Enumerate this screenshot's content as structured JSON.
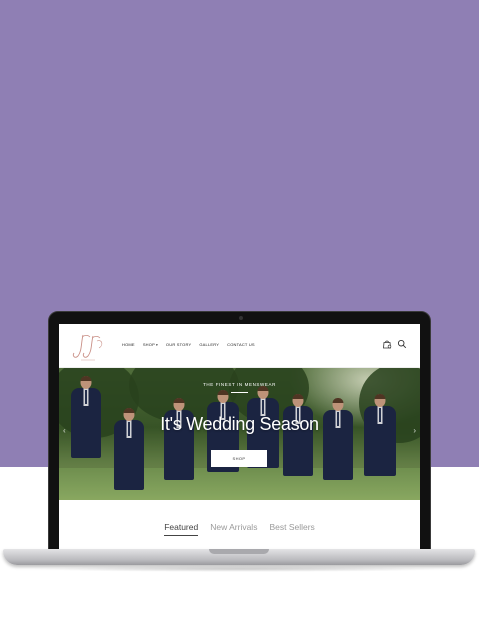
{
  "site": {
    "logo_alt": "J&J",
    "nav": [
      {
        "label": "HOME",
        "has_dropdown": false,
        "icon": ""
      },
      {
        "label": "SHOP",
        "has_dropdown": true,
        "icon": "chevron-down-icon"
      },
      {
        "label": "OUR STORY",
        "has_dropdown": false,
        "icon": ""
      },
      {
        "label": "GALLERY",
        "has_dropdown": false,
        "icon": ""
      },
      {
        "label": "CONTACT US",
        "has_dropdown": false,
        "icon": ""
      }
    ],
    "icons": [
      "shopping-bag-icon",
      "search-icon"
    ],
    "hero": {
      "small_text": "THE FINEST IN MENSWEAR",
      "title": "It's Wedding Season",
      "button_label": "SHOP"
    },
    "tabs": [
      {
        "label": "Featured",
        "active": true
      },
      {
        "label": "New Arrivals",
        "active": false
      },
      {
        "label": "Best Sellers",
        "active": false
      }
    ]
  },
  "colors": {
    "backdrop": "#8f7fb4",
    "suit": "#1f2a4a",
    "accent_logo": "#c98f86"
  }
}
